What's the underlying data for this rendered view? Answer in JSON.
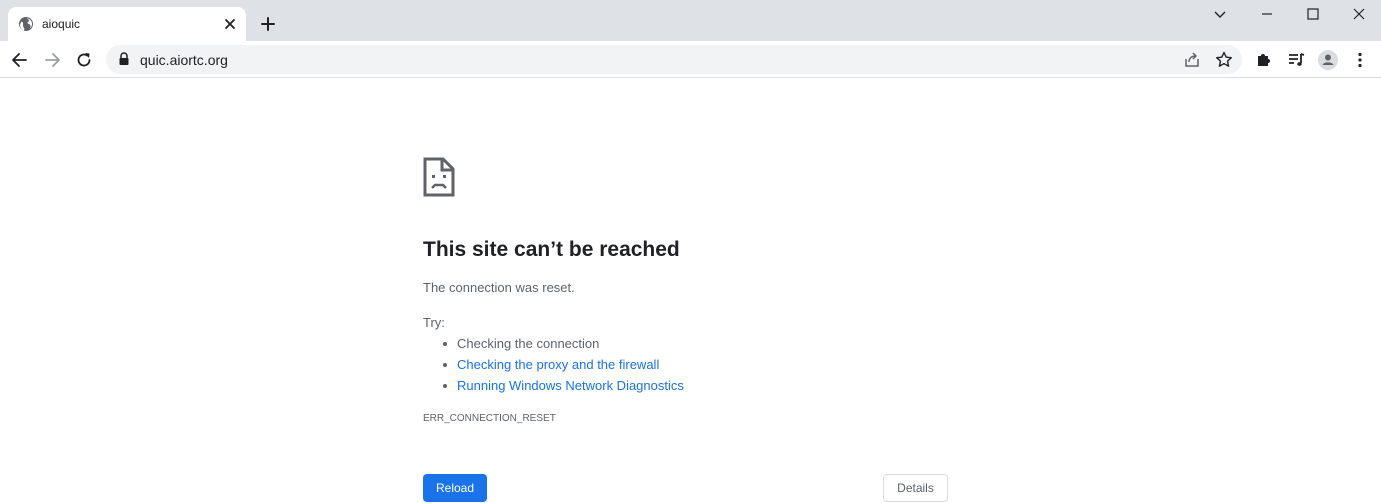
{
  "tab": {
    "title": "aioquic",
    "favicon": "globe-icon",
    "close_icon": "close-icon"
  },
  "new_tab_icon": "plus-icon",
  "window_controls": [
    "chevron-down-icon",
    "minimize-icon",
    "maximize-icon",
    "close-icon"
  ],
  "toolbar": {
    "back_icon": "back-arrow-icon",
    "forward_icon": "forward-arrow-icon",
    "reload_icon": "reload-icon",
    "lock_icon": "lock-icon",
    "url": "quic.aiortc.org",
    "share_icon": "share-icon",
    "bookmark_icon": "star-icon",
    "extensions_icon": "puzzle-icon",
    "media_icon": "media-queue-icon",
    "profile_icon": "profile-icon",
    "menu_icon": "kebab-menu-icon"
  },
  "error_page": {
    "icon": "sad-page-icon",
    "title": "This site can’t be reached",
    "message": "The connection was reset.",
    "try_label": "Try:",
    "suggestions": [
      {
        "text": "Checking the connection",
        "link": false
      },
      {
        "text": "Checking the proxy and the firewall",
        "link": true
      },
      {
        "text": "Running Windows Network Diagnostics",
        "link": true
      }
    ],
    "error_code": "ERR_CONNECTION_RESET",
    "reload_label": "Reload",
    "details_label": "Details"
  },
  "colors": {
    "tabstrip_bg": "#dee1e6",
    "omnibox_bg": "#f1f3f4",
    "link": "#1a73e8",
    "primary_button": "#1a73e8",
    "secondary_text": "#5f6368"
  }
}
